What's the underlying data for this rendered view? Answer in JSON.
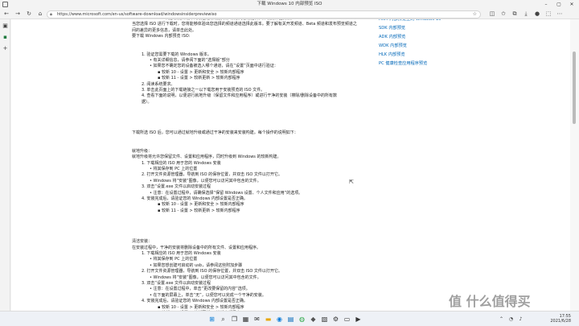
{
  "window": {
    "title": "下载 Windows 10 内部预览 ISO"
  },
  "addressbar": {
    "url": "https://www.microsoft.com/en-us/software-download/windowsinsiderpreviewiso"
  },
  "main": {
    "lines": [
      {
        "cls": "l1",
        "text": "3. Windows 内部预览计划中的设备通常需要以推荐方式进行更新，并收集体验反馈。"
      },
      {
        "cls": "",
        "text": "当您选择 ISO 进行下载时，您将能够体验出您选择的频道通道选择此版本。要了解有关开发频道、Beta 频道和发布预览频道之"
      },
      {
        "cls": "",
        "text": "间的差异的更多信息，请单击此处。"
      },
      {
        "cls": "",
        "text": "要下载 Windows 内部预览 ISO:"
      },
      {
        "cls": "gap",
        "text": ""
      },
      {
        "cls": "l1",
        "text": "1. 验证您需要下载的 Windows 版本。"
      },
      {
        "cls": "l2 bullet",
        "text": "有关详细信息，请参阅下面的“选择版”部分"
      },
      {
        "cls": "l2 bullet",
        "text": "如果您不确定您的设备被选入哪个通道，请在“设置”页面中进行验证："
      },
      {
        "cls": "l3 sq",
        "text": "较新 10 - 设置 > 更新和安全 > 较新内部程序"
      },
      {
        "cls": "l3 sq",
        "text": "较新 11 - 设置 > 较新更新 > 较新内部程序"
      },
      {
        "cls": "l1",
        "text": "2. 阅读系统要求。"
      },
      {
        "cls": "l1",
        "text": "3. 单击此页面上的下载链接之一以下载您用于安装预览的 ISO 文件。"
      },
      {
        "cls": "l1",
        "text": "4. 查看下面的说明，以便进行就地升级（保留文件和应用程序）或进行干净的安装（擦除/删除设备中的所有数"
      },
      {
        "cls": "l1",
        "text": "据）。"
      },
      {
        "cls": "gap-lg",
        "text": ""
      },
      {
        "cls": "",
        "text": "下载所选 ISO 后，您可以通过就地升级或通过干净的安装来安装构建。每个操作的说明如下："
      },
      {
        "cls": "gap",
        "text": ""
      },
      {
        "cls": "",
        "text": "就地升级："
      },
      {
        "cls": "",
        "text": "就地升级将允许您保留文件、设置和应用程序，同时升级到 Windows 的较新构建。"
      },
      {
        "cls": "l1",
        "text": "1. 下载相应的 ISO 用于您的 Windows 安装"
      },
      {
        "cls": "l2 bullet",
        "text": "将其保存到 PC 上的位置"
      },
      {
        "cls": "l1",
        "text": "2. 打开文件资源管理器，导航到 ISO 的保存位置，并双击 ISO 文件以打开它。"
      },
      {
        "cls": "l2 bullet",
        "text": "Windows 将“安装”图像，以便您可以访问其中包含的文件。"
      },
      {
        "cls": "l1",
        "text": "3. 双击“设置.exe 文件以启动安装过程"
      },
      {
        "cls": "l2 bullet",
        "text": "注意：在设置过程中，请确保选择“保留 Windows 设置、个人文件和应用”的选项。"
      },
      {
        "cls": "l1",
        "text": "4. 安装完成后，请验证您的 Windows 内部设置是否正确。"
      },
      {
        "cls": "l3 sq",
        "text": "较新 10 - 设置 > 更新和安全 > 较新内部程序"
      },
      {
        "cls": "l3 sq",
        "text": "较新 11 - 设置 > 较新更新 > 较新内部程序"
      },
      {
        "cls": "gap-lg",
        "text": ""
      },
      {
        "cls": "",
        "text": "清洁安装："
      },
      {
        "cls": "",
        "text": "在安装过程中，干净的安装将删除设备中的所有文件、设置和应用程序。"
      },
      {
        "cls": "l1",
        "text": "1. 下载相应的 ISO 用于您的 Windows 安装"
      },
      {
        "cls": "l2 bullet",
        "text": "将其保存到 PC 上的位置"
      },
      {
        "cls": "l2 bullet",
        "text": "如果您想创建可启动的 usb，请参阅这些附加步骤"
      },
      {
        "cls": "l1",
        "text": "2. 打开文件资源管理器，导航到 ISO 的保存位置，并双击 ISO 文件以打开它。"
      },
      {
        "cls": "l2 bullet",
        "text": "Windows 将“安装”图像，以便您可以访问其中包含的文件。"
      },
      {
        "cls": "l1",
        "text": "3. 双击“设置.exe 文件以启动安装过程"
      },
      {
        "cls": "l2 bullet",
        "text": "注意：在设置过程中，单击“更改要保留的内容”选项。"
      },
      {
        "cls": "l2 bullet",
        "text": "在下面的屏幕上，单击“无”，以便您可以完成一个干净的安装。"
      },
      {
        "cls": "l1",
        "text": "4. 安装完成后，请验证您的 Windows 内部设置是否正确。"
      },
      {
        "cls": "l3 sq",
        "text": "较新 10 - 设置 > 更新和安全 > 较新内部程序"
      },
      {
        "cls": "l3 sq",
        "text": "较新 11 - 设置 > 较新更新 > 较新内部程序"
      }
    ]
  },
  "sidebar_links": [
    "ARM 内部预览上的 Windows 10",
    "SDK 内部预览",
    "ADK 内部预览",
    "WDK 内部预览",
    "HLK 内部预览",
    "PC 健康检查应用程序预览"
  ],
  "taskbar": {
    "time": "17:55",
    "date": "2021/6/28"
  },
  "watermark": "值 什么值得买"
}
